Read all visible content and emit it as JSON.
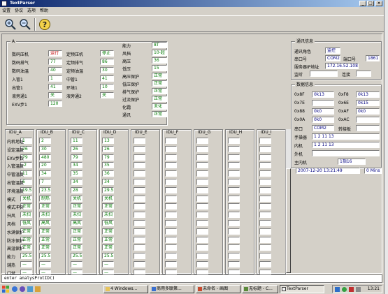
{
  "window": {
    "title": "TextParser",
    "minimize": "_",
    "maximize": "□",
    "close": "×"
  },
  "menu": [
    "设置",
    "协议",
    "选项",
    "帮助"
  ],
  "toolbar": {
    "zoom_in": "zoom-in-icon",
    "zoom_out": "zoom-out-icon",
    "help": "help-icon"
  },
  "main": {
    "group_a_label": "A",
    "left_params": [
      {
        "label": "数码压机",
        "value": "运行",
        "tone": "r"
      },
      {
        "label": "数码排气",
        "value": "77",
        "tone": "g"
      },
      {
        "label": "数码油温",
        "value": "40",
        "tone": "g"
      },
      {
        "label": "入管1",
        "value": "1",
        "tone": "g"
      },
      {
        "label": "出管1",
        "value": "41",
        "tone": "g"
      },
      {
        "label": "液旁通1",
        "value": "关",
        "tone": "g"
      },
      {
        "label": "EXV步1",
        "value": "120",
        "tone": "g"
      }
    ],
    "mid_params": [
      {
        "label": "定频压机",
        "value": "停止",
        "tone": "g"
      },
      {
        "label": "定频排气",
        "value": "86",
        "tone": "g"
      },
      {
        "label": "定频油温",
        "value": "30",
        "tone": "g"
      },
      {
        "label": "中管1",
        "value": "41",
        "tone": "g"
      },
      {
        "label": "环境1",
        "value": "10",
        "tone": "g"
      },
      {
        "label": "液旁通2",
        "value": "关",
        "tone": "g"
      }
    ],
    "right_params": [
      {
        "label": "能力",
        "value": "8T",
        "tone": "g"
      },
      {
        "label": "风档",
        "value": "10-超",
        "tone": "g"
      },
      {
        "label": "高压",
        "value": "36",
        "tone": "g"
      },
      {
        "label": "低压",
        "value": "15",
        "tone": "g"
      },
      {
        "label": "高压保护",
        "value": "正常",
        "tone": "g"
      },
      {
        "label": "低压保护",
        "value": "正常",
        "tone": "g"
      },
      {
        "label": "排气保护",
        "value": "正常",
        "tone": "g"
      },
      {
        "label": "过流保护",
        "value": "正常",
        "tone": "g"
      },
      {
        "label": "化霜",
        "value": "未化",
        "tone": "g"
      },
      {
        "label": "通讯",
        "value": "正常",
        "tone": "g"
      }
    ]
  },
  "comm": {
    "title": "通讯信息",
    "role_label": "通讯角色",
    "role_value": "监控",
    "port_label": "串口号",
    "port_value": "COM2",
    "portnum_label": "端口号",
    "portnum_value": "1861",
    "server_label": "服务器IP地址",
    "server_value": "172.16.52.108",
    "listen_label": "监听",
    "connect_label": "连接"
  },
  "data_info": {
    "title": "数据信息",
    "rows": [
      {
        "l1": "0x8F",
        "v1": "0k13",
        "l2": "0xF8",
        "v2": "0k13"
      },
      {
        "l1": "0x7E",
        "v1": "",
        "l2": "0x6E",
        "v2": "0k15"
      },
      {
        "l1": "0x88",
        "v1": "0k0",
        "l2": "0xAF",
        "v2": "0k0"
      },
      {
        "l1": "0x0A",
        "v1": "0k0",
        "l2": "0xAC",
        "v2": ""
      }
    ],
    "serial_label": "串口",
    "serial_value": "COM2",
    "convert_label": "转接板",
    "hand_label": "手操器",
    "hand_value": "1  2  11  13",
    "inner_label": "内机",
    "inner_value": "1  2  11  13",
    "outer_label": "外机",
    "outer_value": "",
    "main_label": "主内机",
    "main_value": "1指16",
    "datetime": "2007-12-20 13:21:49",
    "mins": "0 Mins"
  },
  "idu": {
    "headers": [
      "IDU_A",
      "IDU_B",
      "IDU_C",
      "IDU_D",
      "IDU_E",
      "IDU_F",
      "IDU_G",
      "IDU_H",
      "IDU_I"
    ],
    "row_labels": [
      "内机地址",
      "设定温度",
      "EXV步数",
      "入管温度",
      "中管温度",
      "出管温度",
      "环境温度",
      "模式",
      "模式冲突",
      "扫风",
      "风档",
      "水满保护",
      "防冻保护",
      "高温保护",
      "能力",
      "辅热",
      "门禁"
    ],
    "cols": [
      [
        "1",
        "26",
        "79",
        "-2",
        "11",
        "6",
        "19.5",
        "关机",
        "正常",
        "未扫",
        "低风",
        "正常",
        "正常",
        "正常",
        "25.5",
        "—",
        "—"
      ],
      [
        "2",
        "30",
        "480",
        "20",
        "34",
        "7",
        "23.5",
        "制热",
        "正常",
        "未扫",
        "高风",
        "正常",
        "正常",
        "正常",
        "25.5",
        "—",
        "—"
      ],
      [
        "11",
        "26",
        "79",
        "34",
        "35",
        "34",
        "28",
        "关机",
        "正常",
        "未扫",
        "高风",
        "正常",
        "正常",
        "正常",
        "25.5",
        "—",
        "—"
      ],
      [
        "13",
        "26",
        "79",
        "35",
        "36",
        "34",
        "29.5",
        "关机",
        "正常",
        "未扫",
        "低风",
        "正常",
        "正常",
        "正常",
        "25.5",
        "—",
        "—"
      ]
    ]
  },
  "command_line": "enter analysProtID()",
  "taskbar": {
    "items": [
      "4 Windows...",
      "商用多联第...",
      "未命名 - 画图",
      "无标题 - C...",
      "TextParser"
    ],
    "clock": "13:21"
  }
}
